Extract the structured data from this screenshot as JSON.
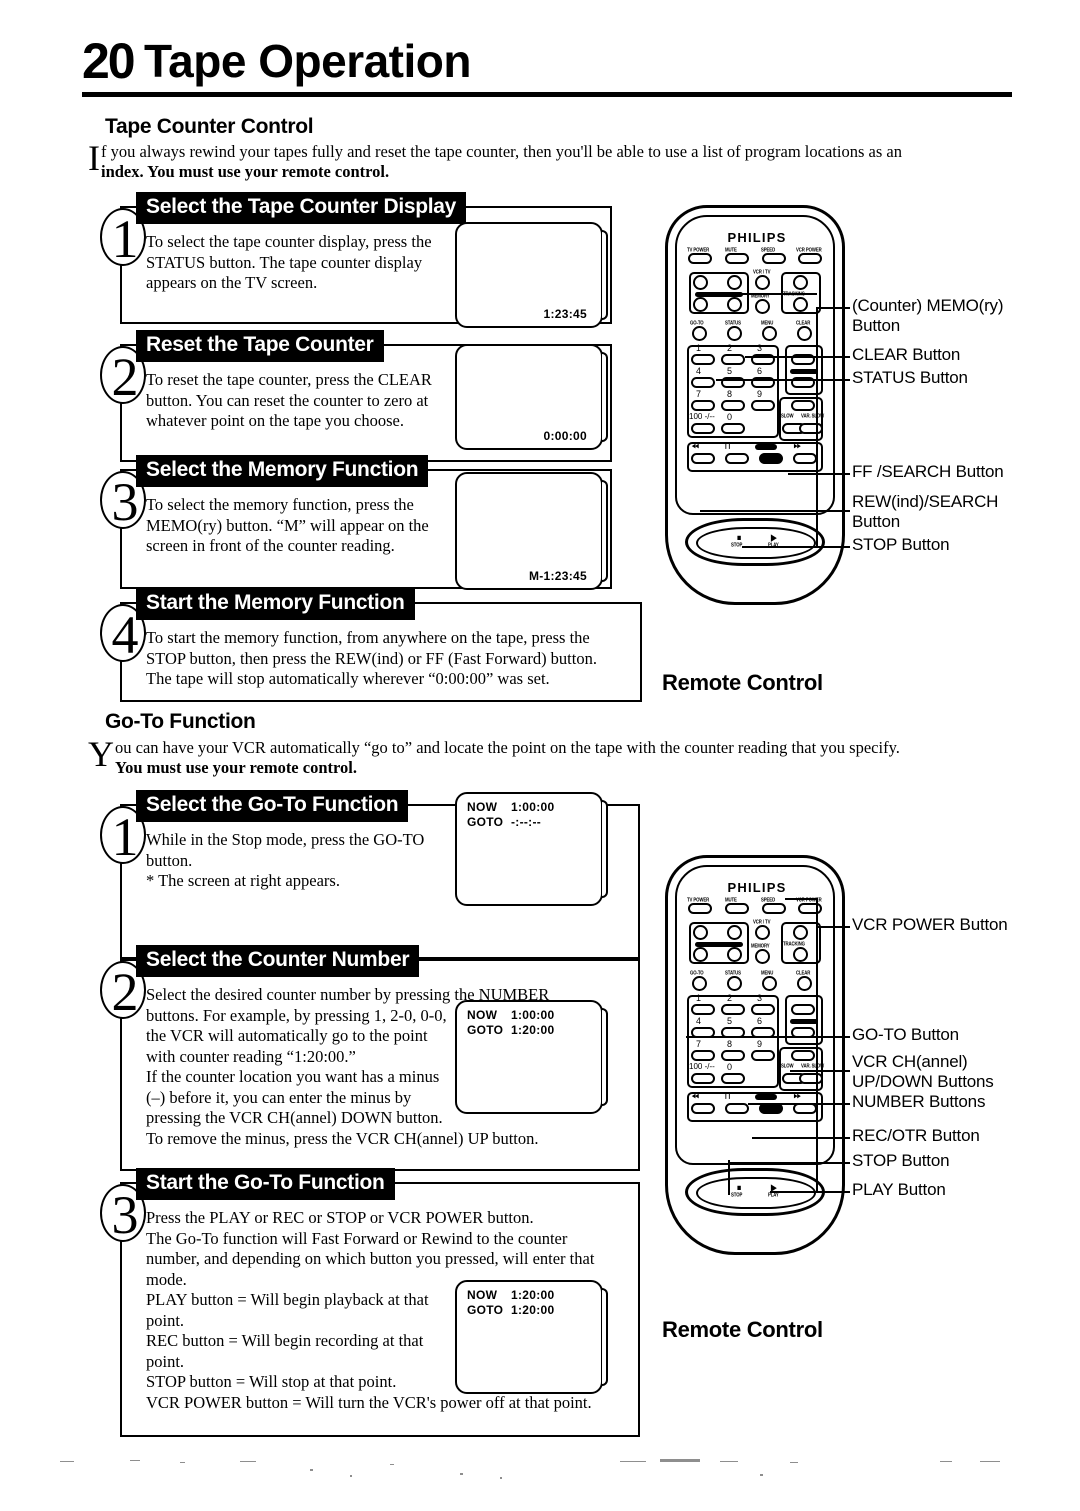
{
  "header": {
    "page_number": "20",
    "title": "Tape Operation"
  },
  "sections": [
    {
      "heading": "Tape Counter Control",
      "intro_dropcap": "I",
      "intro_line1": "f you always rewind your tapes fully and reset the tape counter, then you'll be able to use a list of program locations as an",
      "intro_line2": "index. You must use your remote control."
    },
    {
      "heading": "Go-To Function",
      "intro_dropcap": "Y",
      "intro_line1": "ou can have your VCR automatically “go to” and locate the point on the tape with the counter reading that you specify.",
      "intro_line2": "You must use your remote control."
    }
  ],
  "counter_steps": [
    {
      "number": "1",
      "title": "Select the Tape Counter Display",
      "lines": [
        "To select the tape counter display, press the",
        "STATUS button. The tape counter display",
        "appears on the TV screen."
      ],
      "screen": {
        "type": "counter",
        "value": "1:23:45"
      }
    },
    {
      "number": "2",
      "title": "Reset the Tape Counter",
      "lines": [
        "To reset the tape counter, press the CLEAR",
        "button. You can reset the counter to zero at",
        "whatever point on the tape you choose."
      ],
      "screen": {
        "type": "counter",
        "value": "0:00:00"
      }
    },
    {
      "number": "3",
      "title": "Select the Memory Function",
      "lines": [
        "To select the memory function, press the",
        "MEMO(ry) button. “M” will appear on the",
        "screen in front of the counter reading."
      ],
      "screen": {
        "type": "counter",
        "value": "M-1:23:45"
      }
    },
    {
      "number": "4",
      "title": "Start the Memory Function",
      "lines": [
        "To start the memory function, from anywhere on the tape, press the",
        "STOP button, then press the REW(ind) or FF (Fast Forward) button.",
        "The tape will stop automatically wherever “0:00:00” was set."
      ],
      "screen": null
    }
  ],
  "goto_steps": [
    {
      "number": "1",
      "title": "Select the Go-To Function",
      "lines": [
        "While in the Stop mode, press the GO-TO",
        "button.",
        "* The screen at right appears."
      ],
      "screen": {
        "type": "goto",
        "now_label": "NOW",
        "now_value": "1:00:00",
        "goto_label": "GOTO",
        "goto_value": "-:--:--"
      }
    },
    {
      "number": "2",
      "title": "Select the Counter Number",
      "lines": [
        "Select the desired counter number by pressing the NUMBER",
        "buttons. For example, by pressing 1, 2-0, 0-0,",
        "the VCR will automatically go to the point",
        "with counter reading “1:20:00.”",
        "If the counter location you want has a minus",
        "(–) before it, you can enter the minus by",
        "pressing the VCR CH(annel) DOWN button.",
        "To remove the minus, press the VCR CH(annel) UP button."
      ],
      "screen": {
        "type": "goto",
        "now_label": "NOW",
        "now_value": "1:00:00",
        "goto_label": "GOTO",
        "goto_value": "1:20:00"
      }
    },
    {
      "number": "3",
      "title": "Start the Go-To Function",
      "lines": [
        "Press the PLAY or REC or STOP or VCR POWER button.",
        "The Go-To function will Fast Forward or Rewind to the counter",
        "number, and depending on which button you pressed, will enter that",
        "mode.",
        "PLAY button = Will begin playback at that",
        "point.",
        "REC button = Will begin recording at that",
        "point.",
        "STOP button = Will stop at that point.",
        "VCR POWER button = Will turn the VCR's power off at that point."
      ],
      "screen": {
        "type": "goto",
        "now_label": "NOW",
        "now_value": "1:20:00",
        "goto_label": "GOTO",
        "goto_value": "1:20:00"
      }
    }
  ],
  "remote": {
    "brand": "PHILIPS",
    "caption": "Remote Control",
    "top_row": [
      "TV POWER",
      "MUTE",
      "SPEED",
      "VCR POWER"
    ],
    "mid_labels": [
      "VCR / TV",
      "MEMORY",
      "TRACKING"
    ],
    "function_row": [
      "GO-TO",
      "STATUS",
      "MENU",
      "CLEAR"
    ],
    "numbers": [
      "1",
      "2",
      "3",
      "4",
      "5",
      "6",
      "7",
      "8",
      "9",
      "100 -/--",
      "0"
    ],
    "slow_labels": [
      "SLOW",
      "VAR. SLOW"
    ],
    "transport_labels": [
      "REW",
      "PAUSE/STILL",
      "REC/OTR",
      "FF"
    ],
    "pad_labels": [
      "STOP",
      "PLAY"
    ]
  },
  "callouts_top": [
    "(Counter) MEMO(ry)\nButton",
    "CLEAR Button",
    "STATUS Button",
    "FF /SEARCH Button",
    "REW(ind)/SEARCH\nButton",
    "STOP Button"
  ],
  "callouts_bottom": [
    "VCR POWER Button",
    "GO-TO Button",
    "VCR CH(annel)\nUP/DOWN Buttons",
    "NUMBER Buttons",
    "REC/OTR Button",
    "STOP Button",
    "PLAY Button"
  ]
}
